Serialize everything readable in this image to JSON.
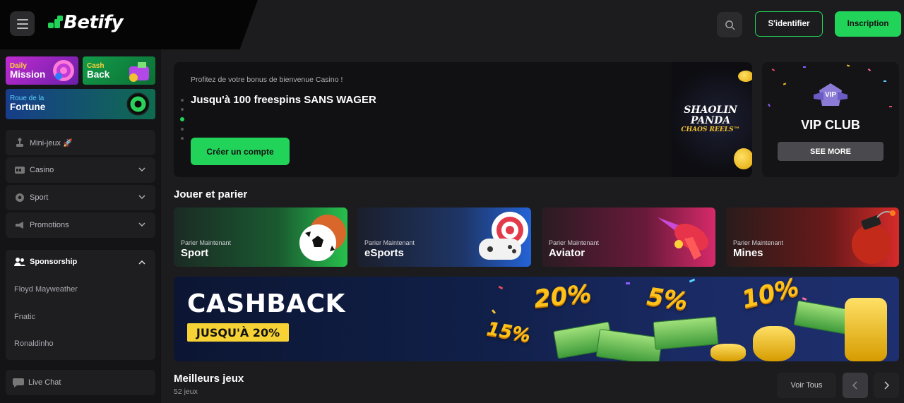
{
  "header": {
    "logo_text": "Betify",
    "login_label": "S'identifier",
    "signup_label": "Inscription",
    "brand_color": "#22d35a"
  },
  "sidebar": {
    "promos": [
      {
        "small": "Daily",
        "big": "Mission"
      },
      {
        "small": "Cash",
        "big": "Back"
      },
      {
        "small": "Roue de la",
        "big": "Fortune"
      }
    ],
    "items": [
      {
        "label": "Mini-jeux 🚀",
        "icon": "joystick-icon",
        "has_chevron": false
      },
      {
        "label": "Casino",
        "icon": "slot-machine-icon",
        "has_chevron": true
      },
      {
        "label": "Sport",
        "icon": "soccer-ball-icon",
        "has_chevron": true
      },
      {
        "label": "Promotions",
        "icon": "megaphone-icon",
        "has_chevron": true
      }
    ],
    "sponsorship": {
      "label": "Sponsorship",
      "items": [
        "Floyd Mayweather",
        "Fnatic",
        "Ronaldinho"
      ]
    },
    "live_chat": "Live Chat"
  },
  "hero": {
    "subtitle": "Profitez de votre bonus de bienvenue Casino !",
    "title": "Jusqu'à 100 freespins SANS WAGER",
    "cta": "Créer un compte",
    "game_logo": [
      "SHAOLIN",
      "PANDA",
      "CHAOS REELS™"
    ]
  },
  "vip": {
    "badge": "VIP",
    "title": "VIP CLUB",
    "button": "SEE MORE"
  },
  "play_section": {
    "title": "Jouer et parier",
    "cards": [
      {
        "small": "Parier Maintenant",
        "big": "Sport"
      },
      {
        "small": "Parier Maintenant",
        "big": "eSports"
      },
      {
        "small": "Parier Maintenant",
        "big": "Aviator"
      },
      {
        "small": "Parier Maintenant",
        "big": "Mines"
      }
    ]
  },
  "cashback_banner": {
    "title": "CASHBACK",
    "tag": "JUSQU'À 20%",
    "percents": [
      "20%",
      "5%",
      "10%",
      "15%"
    ]
  },
  "best_games": {
    "title": "Meilleurs jeux",
    "count": "52 jeux",
    "view_all": "Voir Tous"
  }
}
